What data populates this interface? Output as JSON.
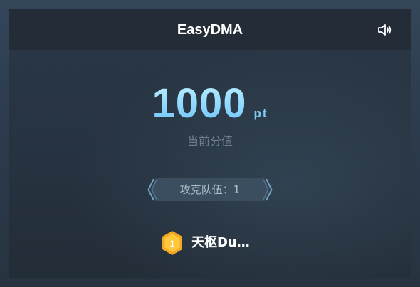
{
  "header": {
    "title": "EasyDMA",
    "sound_icon": "speaker-icon"
  },
  "score": {
    "value": "1000",
    "unit": "pt",
    "label": "当前分值"
  },
  "team": {
    "label": "攻克队伍：1"
  },
  "ranking": [
    {
      "rank": "1",
      "name": "天枢Du…",
      "medal_color": "#f5a623"
    }
  ],
  "colors": {
    "score_accent": "#8fd8ff",
    "medal": "#f5a623",
    "header_bg": "#232c37"
  }
}
